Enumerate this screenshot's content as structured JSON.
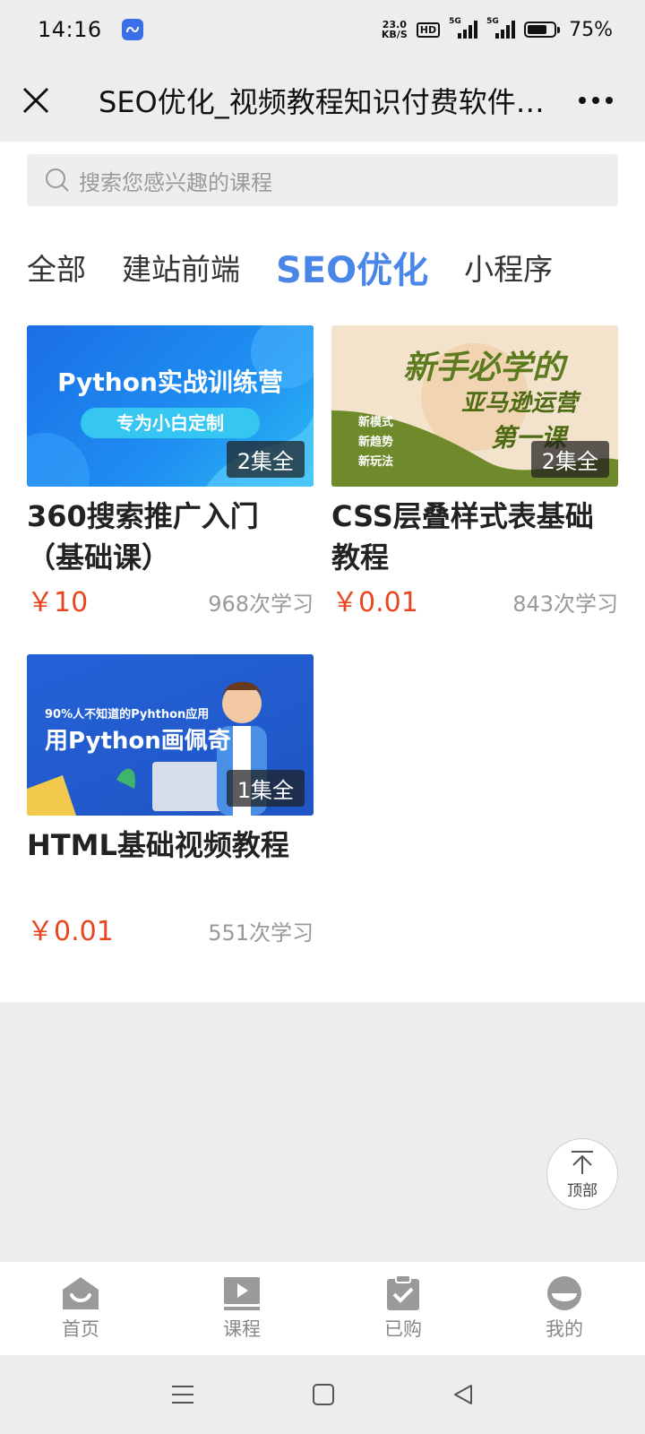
{
  "status_bar": {
    "time": "14:16",
    "net_speed_value": "23.0",
    "net_speed_unit": "KB/S",
    "hd_label": "HD",
    "sim1_label": "5G",
    "sim2_label": "5G",
    "battery_percent": "75%",
    "battery_level": 0.75
  },
  "header": {
    "title": "SEO优化_视频教程知识付费软件系统"
  },
  "search": {
    "placeholder": "搜索您感兴趣的课程"
  },
  "tabs": [
    {
      "label": "全部",
      "active": false
    },
    {
      "label": "建站前端",
      "active": false
    },
    {
      "label": "SEO优化",
      "active": true
    },
    {
      "label": "小程序",
      "active": false
    }
  ],
  "courses": [
    {
      "title": "360搜索推广入门（基础课）",
      "price": "￥10",
      "learners": "968次学习",
      "episodes": "2集全",
      "thumb_line1": "Python实战训练营",
      "thumb_line2": "专为小白定制"
    },
    {
      "title": "CSS层叠样式表基础教程",
      "price": "￥0.01",
      "learners": "843次学习",
      "episodes": "2集全",
      "thumb_line1": "新手必学的",
      "thumb_line2": "亚马逊运营",
      "thumb_line3": "第一课",
      "thumb_bullets": [
        "新模式",
        "新趋势",
        "新玩法"
      ]
    },
    {
      "title": "HTML基础视频教程",
      "price": "￥0.01",
      "learners": "551次学习",
      "episodes": "1集全",
      "thumb_line1": "90%人不知道的Pyhthon应用",
      "thumb_line2": "用Python画佩奇"
    }
  ],
  "back_to_top": {
    "label": "顶部"
  },
  "bottom_nav": [
    {
      "label": "首页",
      "icon": "home-icon"
    },
    {
      "label": "课程",
      "icon": "play-icon"
    },
    {
      "label": "已购",
      "icon": "clipboard-check-icon"
    },
    {
      "label": "我的",
      "icon": "user-icon"
    }
  ],
  "colors": {
    "accent": "#4a86e8",
    "price": "#e8461e",
    "nav_icon": "#9a9a9a"
  }
}
